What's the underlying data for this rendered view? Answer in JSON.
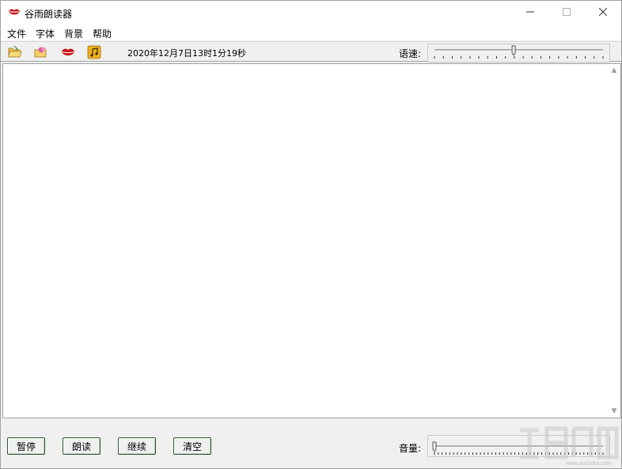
{
  "window": {
    "title": "谷雨朗读器",
    "controls": [
      "minimize-icon",
      "maximize-icon",
      "close-icon"
    ]
  },
  "menu": {
    "items": [
      "文件",
      "字体",
      "背景",
      "帮助"
    ]
  },
  "toolbar": {
    "icons": [
      "open-folder-icon",
      "edit-note-icon",
      "lips-read-icon",
      "music-icon"
    ],
    "datetime": "2020年12月7日13时1分19秒",
    "speed_label": "语速:",
    "speed_level": 0.47
  },
  "editor": {
    "content": ""
  },
  "buttons": {
    "pause": "暂停",
    "read": "朗读",
    "continue": "继续",
    "clear": "清空"
  },
  "volume": {
    "label": "音量:",
    "level": 0.0
  },
  "colors": {
    "accent_red": "#c41616",
    "button_border": "#2a5a2a"
  }
}
